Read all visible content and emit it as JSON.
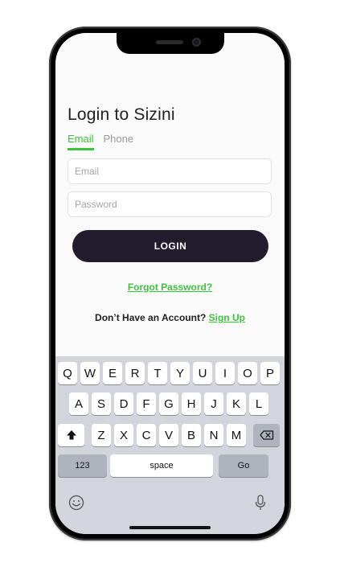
{
  "login": {
    "title": "Login to Sizini",
    "tabs": [
      {
        "label": "Email",
        "active": true
      },
      {
        "label": "Phone",
        "active": false
      }
    ],
    "email_placeholder": "Email",
    "password_placeholder": "Password",
    "email_value": "",
    "password_value": "",
    "login_button": "LOGIN",
    "forgot_password": "Forgot Password?",
    "signup_prompt": "Don’t Have an Account?",
    "signup_link": "Sign Up",
    "accent_color": "#3dc43d",
    "button_color": "#231b2e"
  },
  "keyboard": {
    "row1": [
      "Q",
      "W",
      "E",
      "R",
      "T",
      "Y",
      "U",
      "I",
      "O",
      "P"
    ],
    "row2": [
      "A",
      "S",
      "D",
      "F",
      "G",
      "H",
      "J",
      "K",
      "L"
    ],
    "row3": [
      "Z",
      "X",
      "C",
      "V",
      "B",
      "N",
      "M"
    ],
    "shift_icon": "shift-arrow-icon",
    "backspace_icon": "backspace-icon",
    "numbers_label": "123",
    "space_label": "space",
    "go_label": "Go",
    "emoji_icon": "emoji-icon",
    "mic_icon": "microphone-icon"
  }
}
